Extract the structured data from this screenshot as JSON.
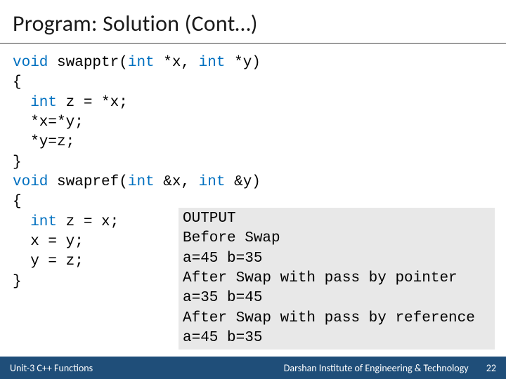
{
  "title": "Program: Solution (Cont…)",
  "code": {
    "l1a": "void",
    "l1b": " swapptr(",
    "l1c": "int",
    "l1d": " *x, ",
    "l1e": "int",
    "l1f": " *y)",
    "l2": "{",
    "l3a": "  int",
    "l3b": " z = *x;",
    "l4": "  *x=*y;",
    "l5": "  *y=z;",
    "l6": "}",
    "l7a": "void",
    "l7b": " swapref(",
    "l7c": "int",
    "l7d": " &x, ",
    "l7e": "int",
    "l7f": " &y)",
    "l8": "{",
    "l9a": "  int",
    "l9b": " z = x;",
    "l10": "  x = y;",
    "l11": "  y = z;",
    "l12": "}"
  },
  "output": {
    "l1": "OUTPUT",
    "l2": "Before Swap",
    "l3": "a=45 b=35",
    "l4": "After Swap with pass by pointer",
    "l5": "a=35 b=45",
    "l6": "After Swap with pass by reference",
    "l7": "a=45 b=35"
  },
  "footer": {
    "left": "Unit-3 C++ Functions",
    "right": "Darshan Institute of Engineering & Technology",
    "page": "22"
  }
}
